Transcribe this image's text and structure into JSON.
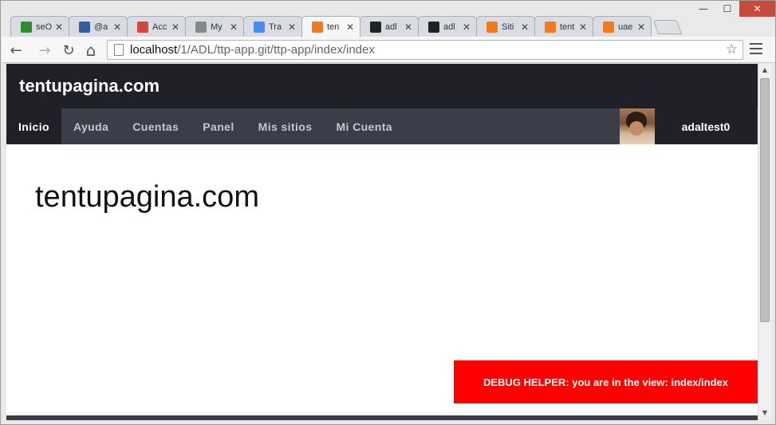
{
  "window": {
    "minimize_glyph": "—",
    "maximize_glyph": "☐",
    "close_glyph": "✕"
  },
  "tabs": [
    {
      "label": "seO",
      "icon": "chart-favicon-icon",
      "color": "#2e8b2e",
      "close": "✕"
    },
    {
      "label": "@a",
      "icon": "tweetdeck-favicon-icon",
      "color": "#2f5f9e",
      "close": "✕"
    },
    {
      "label": "Acc",
      "icon": "gmail-favicon-icon",
      "color": "#d44638",
      "close": "✕"
    },
    {
      "label": "My",
      "icon": "blank-page-favicon-icon",
      "color": "#888888",
      "close": "✕"
    },
    {
      "label": "Tra",
      "icon": "translate-favicon-icon",
      "color": "#4a8af4",
      "close": "✕"
    },
    {
      "label": "ten",
      "icon": "xampp-favicon-icon",
      "color": "#f07a1e",
      "close": "✕",
      "active": true
    },
    {
      "label": "adl",
      "icon": "github-favicon-icon",
      "color": "#222222",
      "close": "✕"
    },
    {
      "label": "adl",
      "icon": "github-favicon-icon",
      "color": "#222222",
      "close": "✕"
    },
    {
      "label": "Siti",
      "icon": "xampp-favicon-icon",
      "color": "#f07a1e",
      "close": "✕"
    },
    {
      "label": "tent",
      "icon": "xampp-favicon-icon",
      "color": "#f07a1e",
      "close": "✕"
    },
    {
      "label": "uae",
      "icon": "xampp-favicon-icon",
      "color": "#f07a1e",
      "close": "✕"
    }
  ],
  "toolbar": {
    "back_glyph": "←",
    "forward_glyph": "→",
    "reload_glyph": "↻",
    "home_glyph": "⌂",
    "url_host": "localhost",
    "url_path": "/1/ADL/ttp-app.git/ttp-app/index/index",
    "star_glyph": "☆"
  },
  "site": {
    "title": "tentupagina.com",
    "nav": [
      {
        "label": "Inicio",
        "active": true
      },
      {
        "label": "Ayuda"
      },
      {
        "label": "Cuentas"
      },
      {
        "label": "Panel"
      },
      {
        "label": "Mis sitios"
      },
      {
        "label": "Mi Cuenta"
      }
    ],
    "username": "adaltest0",
    "heading": "tentupagina.com",
    "debug_text": "DEBUG HELPER: you are in the view: index/index"
  },
  "scrollbar": {
    "up_glyph": "▲",
    "down_glyph": "▼"
  }
}
